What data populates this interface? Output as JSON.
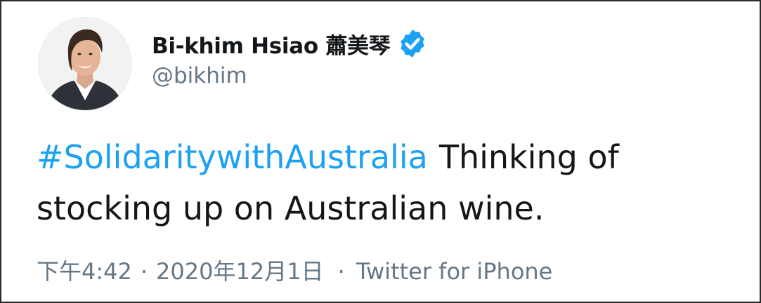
{
  "tweet": {
    "author": {
      "display_name": "Bi-khim Hsiao 蕭美琴",
      "handle": "@bikhim",
      "verified": true
    },
    "text": {
      "hashtag": "#SolidaritywithAustralia",
      "body": "Thinking of stocking up on Australian wine."
    },
    "meta": {
      "time": "下午4:42",
      "separator": "·",
      "date": "2020年12月1日",
      "source": "Twitter for iPhone"
    }
  },
  "colors": {
    "text_primary": "#14171a",
    "text_secondary": "#657786",
    "link_blue": "#1da1f2",
    "verified_blue": "#1da1f2",
    "frame_border": "#2a2a2a"
  },
  "icons": {
    "avatar": "profile-photo",
    "verified": "verified-badge-icon"
  }
}
